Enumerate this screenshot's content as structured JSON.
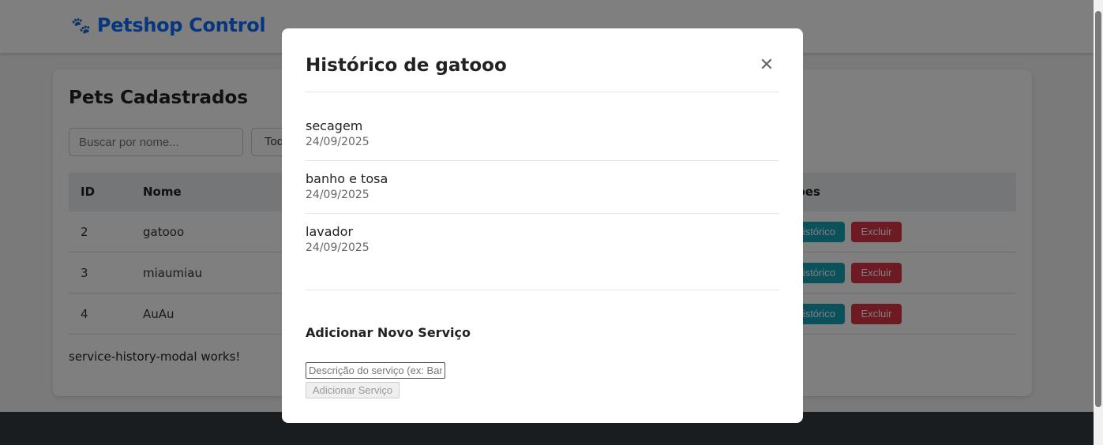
{
  "navbar": {
    "brand_icon": "paw-icon",
    "brand_title": "Petshop Control"
  },
  "card": {
    "title": "Pets Cadastrados",
    "search_placeholder": "Buscar por nome...",
    "filter_value": "Todos",
    "table": {
      "headers": {
        "id": "ID",
        "name": "Nome",
        "actions": "Ações"
      },
      "rows": [
        {
          "id": "2",
          "name": "gatooo",
          "history_label": "Histórico",
          "delete_label": "Excluir"
        },
        {
          "id": "3",
          "name": "miaumiau",
          "history_label": "Histórico",
          "delete_label": "Excluir"
        },
        {
          "id": "4",
          "name": "AuAu",
          "history_label": "Histórico",
          "delete_label": "Excluir"
        }
      ]
    },
    "footer_text": "service-history-modal works!"
  },
  "modal": {
    "title": "Histórico de gatooo",
    "close_icon": "close-icon",
    "services": [
      {
        "description": "secagem",
        "date": "24/09/2025"
      },
      {
        "description": "banho e tosa",
        "date": "24/09/2025"
      },
      {
        "description": "lavador",
        "date": "24/09/2025"
      }
    ],
    "add_title": "Adicionar Novo Serviço",
    "add_placeholder": "Descrição do serviço (ex: Banho)",
    "add_button": "Adicionar Serviço"
  },
  "colors": {
    "brand": "#0d6efd",
    "history_button": "#17a2b8",
    "delete_button": "#dc3545",
    "footer": "#343a40"
  }
}
